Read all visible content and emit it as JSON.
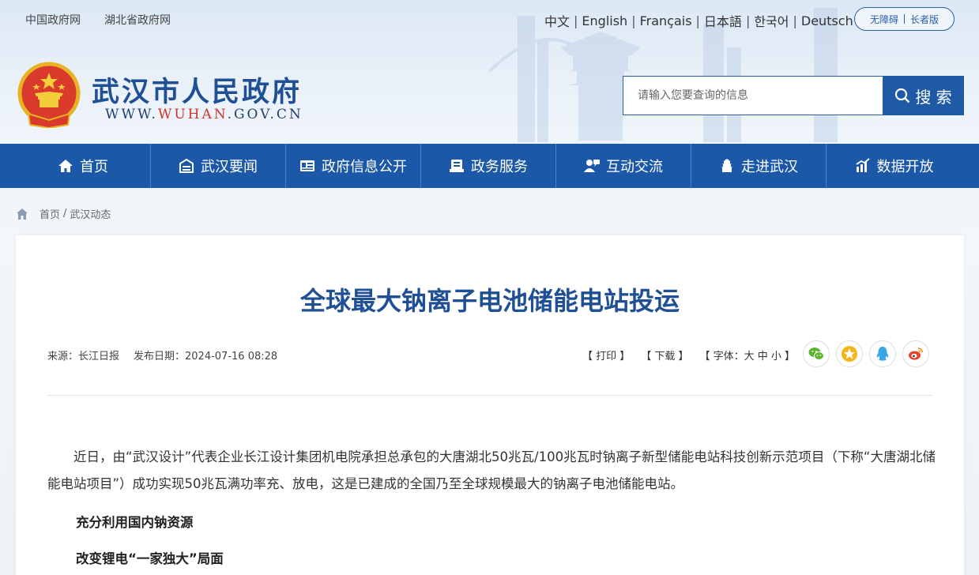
{
  "top_links": [
    "中国政府网",
    "湖北省政府网"
  ],
  "languages": [
    "中文",
    "English",
    "Français",
    "日本語",
    "한국어",
    "Deutsch"
  ],
  "accessibility": {
    "barrier_free": "无障碍",
    "elder": "长者版"
  },
  "site": {
    "title": "武汉市人民政府",
    "url_prefix": "WWW.",
    "url_brand": "WUHAN",
    "url_suffix": ".GOV.CN"
  },
  "search": {
    "placeholder": "请输入您要查询的信息",
    "button": "搜 索"
  },
  "nav": [
    {
      "label": "首页",
      "icon": "home-icon"
    },
    {
      "label": "武汉要闻",
      "icon": "news-icon"
    },
    {
      "label": "政府信息公开",
      "icon": "info-card-icon"
    },
    {
      "label": "政务服务",
      "icon": "service-icon"
    },
    {
      "label": "互动交流",
      "icon": "interaction-icon"
    },
    {
      "label": "走进武汉",
      "icon": "tower-icon"
    },
    {
      "label": "数据开放",
      "icon": "data-chart-icon"
    }
  ],
  "breadcrumb": {
    "home": "首页",
    "current": "武汉动态"
  },
  "article": {
    "title": "全球最大钠离子电池储能电站投运",
    "source": "来源：长江日报",
    "date": "发布日期：2024-07-16 08:28",
    "print": "【 打印 】",
    "download": "【 下载 】",
    "fontsize": "【 字体：大  中  小 】",
    "paragraph1": "近日，由“武汉设计”代表企业长江设计集团机电院承担总承包的大唐湖北50兆瓦/100兆瓦时钠离子新型储能电站科技创新示范项目（下称“大唐湖北储能电站项目”）成功实现50兆瓦满功率充、放电，这是已建成的全国乃至全球规模最大的钠离子电池储能电站。",
    "subhead1": "充分利用国内钠资源",
    "subhead2": "改变锂电“一家独大”局面"
  },
  "share": [
    "wechat-icon",
    "favorite-star-icon",
    "qq-icon",
    "weibo-icon"
  ],
  "colors": {
    "brand_blue": "#1b59a8",
    "title_blue": "#1f4f94",
    "accent_red": "#d0342c"
  }
}
